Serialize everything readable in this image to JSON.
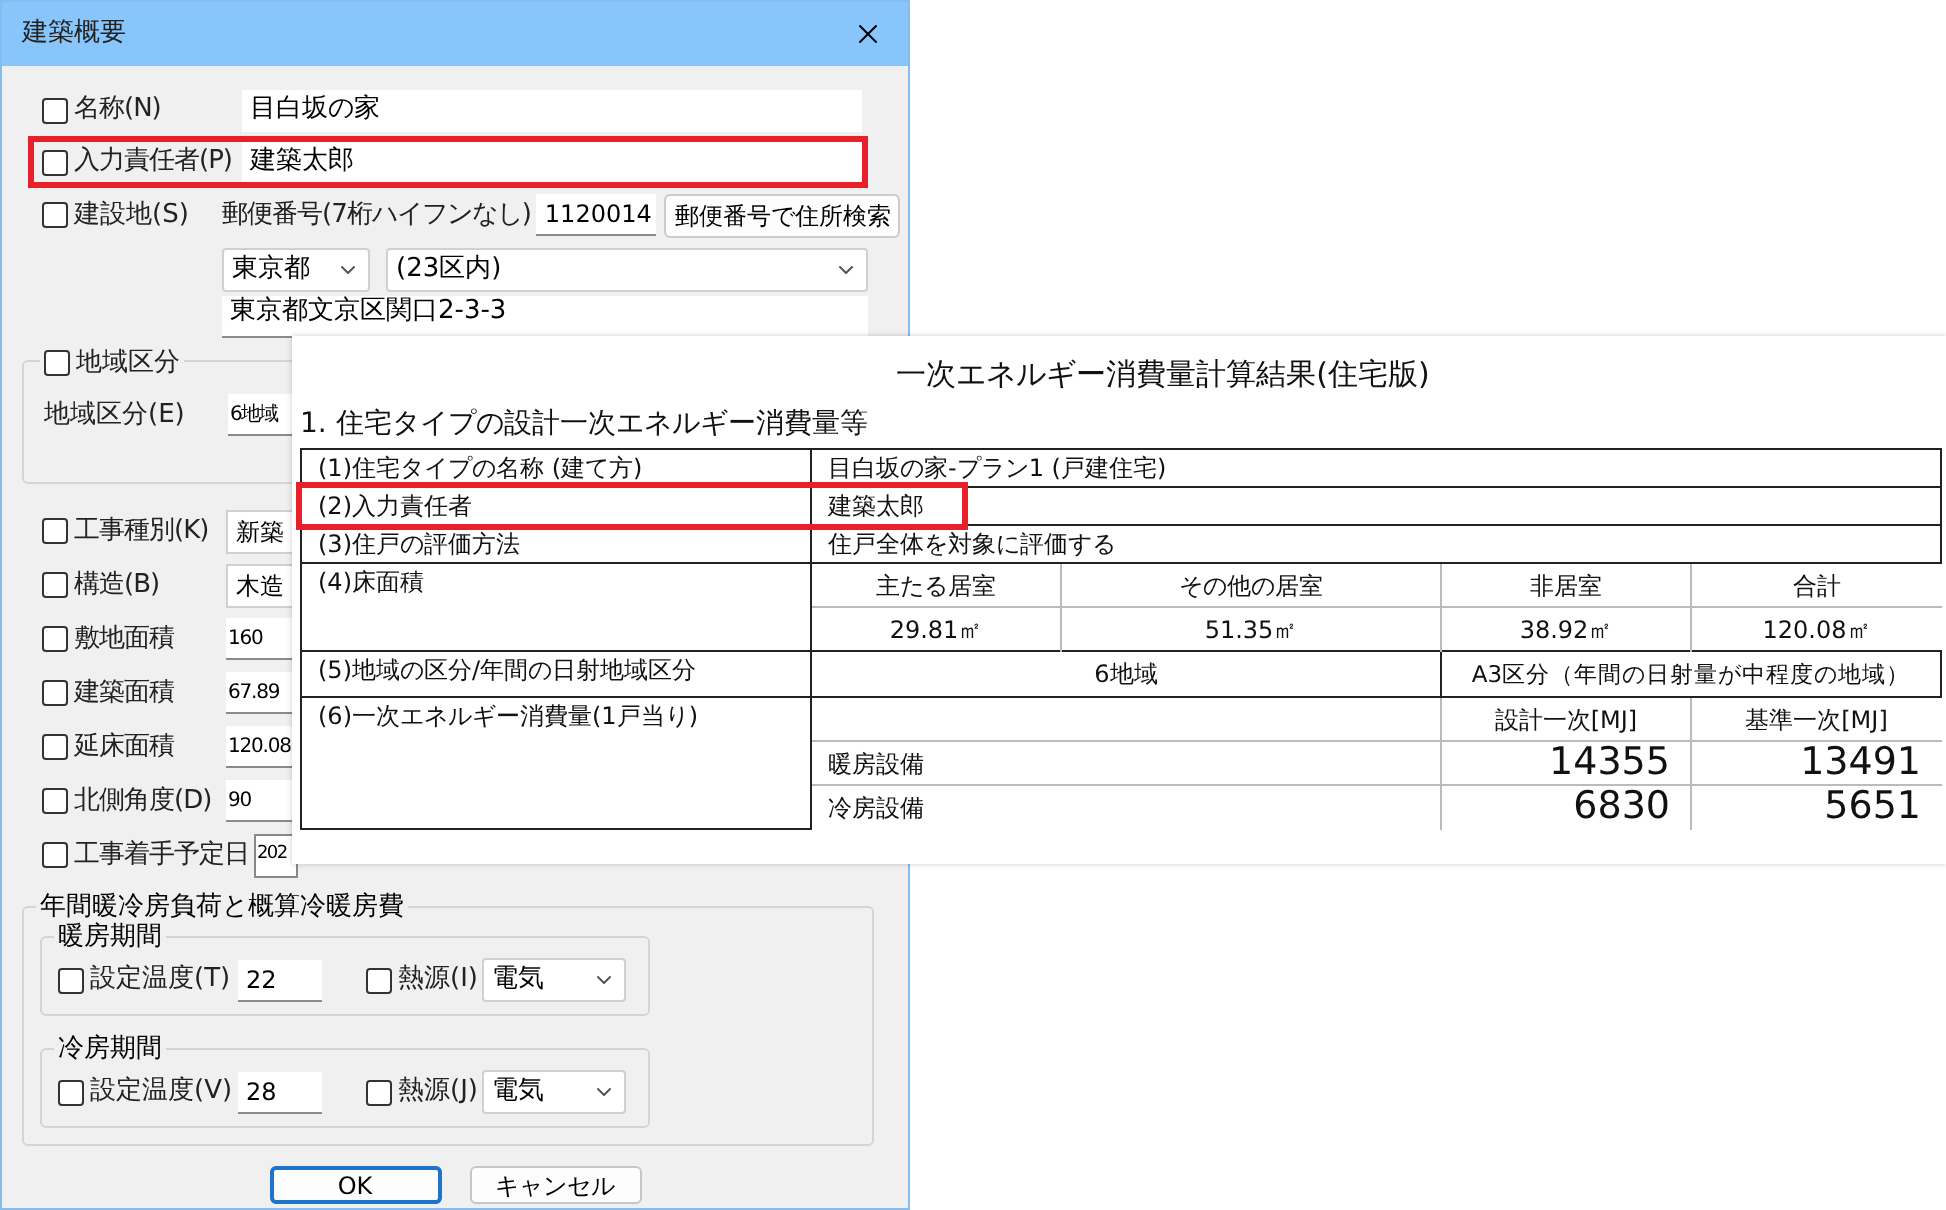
{
  "dialog": {
    "title": "建築概要",
    "basic_rows": [
      {
        "label": "名称(N)",
        "checked": false,
        "value": "目白坂の家",
        "highlighted": false
      },
      {
        "label": "入力責任者(P)",
        "checked": false,
        "value": "建築太郎",
        "highlighted": true
      }
    ],
    "site": {
      "label": "建設地(S)",
      "checked": false,
      "postal_label": "郵便番号(7桁ハイフンなし)",
      "postal_code": "1120014",
      "search_button": "郵便番号で住所検索",
      "prefecture": "東京都",
      "city": "(23区内)",
      "address": "東京都文京区関口2-3-3"
    },
    "region_group": {
      "label": "地域区分",
      "checked": false,
      "field_label": "地域区分(E)",
      "value": "6地域"
    },
    "attribute_rows": [
      {
        "kind": "dropdown",
        "label": "工事種別(K)",
        "checked": false,
        "value": "新築"
      },
      {
        "kind": "dropdown",
        "label": "構造(B)",
        "checked": false,
        "value": "木造"
      },
      {
        "kind": "input",
        "label": "敷地面積",
        "checked": false,
        "value": "160"
      },
      {
        "kind": "input",
        "label": "建築面積",
        "checked": false,
        "value": "67.89"
      },
      {
        "kind": "input",
        "label": "延床面積",
        "checked": false,
        "value": "120.08"
      },
      {
        "kind": "input",
        "label": "北側角度(D)",
        "checked": false,
        "value": "90"
      },
      {
        "kind": "date",
        "label": "工事着手予定日",
        "checked": false,
        "value": "202"
      }
    ],
    "load_group": {
      "title": "年間暖冷房負荷と概算冷暖房費",
      "periods": [
        {
          "title": "暖房期間",
          "temp_label": "設定温度(T)",
          "temp_checked": false,
          "temp": "22",
          "source_label": "熱源(I)",
          "source_checked": false,
          "source": "電気"
        },
        {
          "title": "冷房期間",
          "temp_label": "設定温度(V)",
          "temp_checked": false,
          "temp": "28",
          "source_label": "熱源(J)",
          "source_checked": false,
          "source": "電気"
        }
      ]
    },
    "buttons": [
      {
        "label": "OK",
        "default": true
      },
      {
        "label": "キャンセル",
        "default": false
      }
    ]
  },
  "report": {
    "title": "一次エネルギー消費量計算結果(住宅版)",
    "section": "1. 住宅タイプの設計一次エネルギー消費量等",
    "rows": [
      {
        "kind": "text",
        "label": "(1)住宅タイプの名称 (建て方)",
        "value": "目白坂の家-プラン1 (戸建住宅)",
        "highlighted": false
      },
      {
        "kind": "text",
        "label": "(2)入力責任者",
        "value": "建築太郎",
        "highlighted": true
      },
      {
        "kind": "text",
        "label": "(3)住戸の評価方法",
        "value": "住戸全体を対象に評価する",
        "highlighted": false
      },
      {
        "kind": "area",
        "label": "(4)床面積",
        "columns": [
          "主たる居室",
          "その他の居室",
          "非居室",
          "合計"
        ],
        "values": [
          "29.81㎡",
          "51.35㎡",
          "38.92㎡",
          "120.08㎡"
        ],
        "highlighted": false
      },
      {
        "kind": "region",
        "label": "(5)地域の区分/年間の日射地域区分",
        "values": [
          "6地域",
          "A3区分（年間の日射量が中程度の地域）"
        ],
        "highlighted": false
      },
      {
        "kind": "energy",
        "label": "(6)一次エネルギー消費量(1戸当り)",
        "columns": [
          "設計一次[MJ]",
          "基準一次[MJ]"
        ],
        "items": [
          {
            "name": "暖房設備",
            "values": [
              "14355",
              "13491"
            ]
          },
          {
            "name": "冷房設備",
            "values": [
              "6830",
              "5651"
            ]
          }
        ],
        "highlighted": false
      }
    ]
  }
}
